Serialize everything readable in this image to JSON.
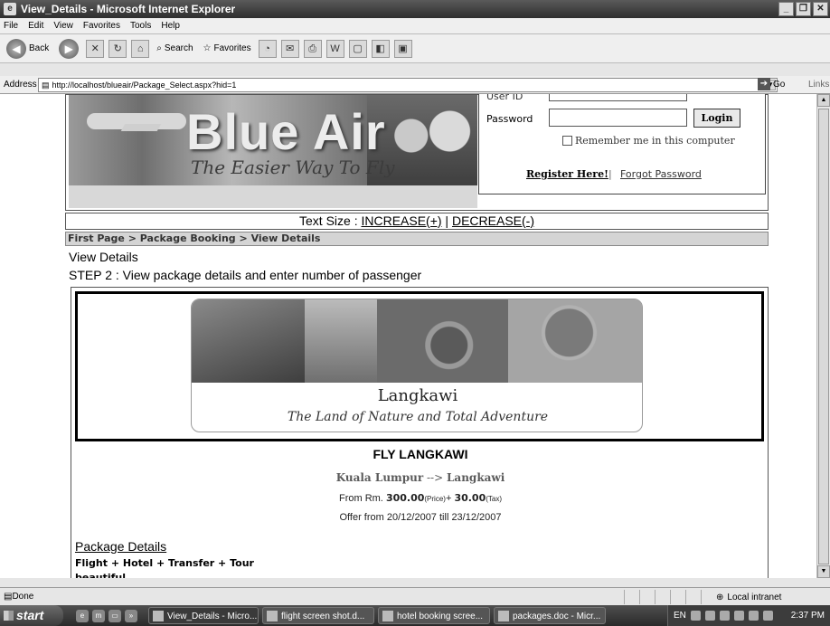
{
  "window": {
    "title": "View_Details - Microsoft Internet Explorer"
  },
  "menubar": [
    "File",
    "Edit",
    "View",
    "Favorites",
    "Tools",
    "Help"
  ],
  "toolbar": {
    "back": "Back",
    "search": "Search",
    "favorites": "Favorites"
  },
  "address": {
    "label": "Address",
    "url": "http://localhost/blueair/Package_Select.aspx?hid=1",
    "go": "Go",
    "links": "Links"
  },
  "banner": {
    "brand": "Blue Air",
    "tagline": "The Easier Way To Fly"
  },
  "login": {
    "user_id_label": "User ID",
    "password_label": "Password",
    "login_button": "Login",
    "remember": "Remember me in this computer",
    "register": "Register Here!",
    "separator": "|",
    "forgot": "Forgot Password"
  },
  "text_size": {
    "label": "Text Size  : ",
    "increase": "INCREASE(+)",
    "sep": " | ",
    "decrease": "DECREASE(-)"
  },
  "breadcrumb": {
    "first": "First Page",
    "sep": " > ",
    "booking": "Package Booking",
    "current": "View Details"
  },
  "page": {
    "title": "View Details",
    "step": "STEP 2 : View package details and enter number of passenger"
  },
  "package": {
    "image_caption": "Langkawi",
    "image_subcaption": "The Land of Nature and Total Adventure",
    "name": "FLY LANGKAWI",
    "from_city": "Kuala Lumpur",
    "arrow": " --> ",
    "to_city": "Langkawi",
    "price_prefix": "From Rm. ",
    "price": "300.00",
    "price_tag": "(Price)",
    "plus": "+ ",
    "tax": "30.00",
    "tax_tag": "(Tax)",
    "offer_prefix": "Offer from ",
    "offer_from": "20/12/2007",
    "offer_mid": " till ",
    "offer_to": "23/12/2007",
    "details_heading": "Package Details",
    "details_line1": "Flight + Hotel + Transfer + Tour",
    "details_line2": "beautiful"
  },
  "statusbar": {
    "status": "Done",
    "zone": "Local intranet"
  },
  "taskbar": {
    "start": "start",
    "tasks": [
      "View_Details - Micro...",
      "flight screen shot.d...",
      "hotel booking scree...",
      "packages.doc - Micr..."
    ],
    "lang": "EN",
    "clock": "2:37 PM"
  }
}
